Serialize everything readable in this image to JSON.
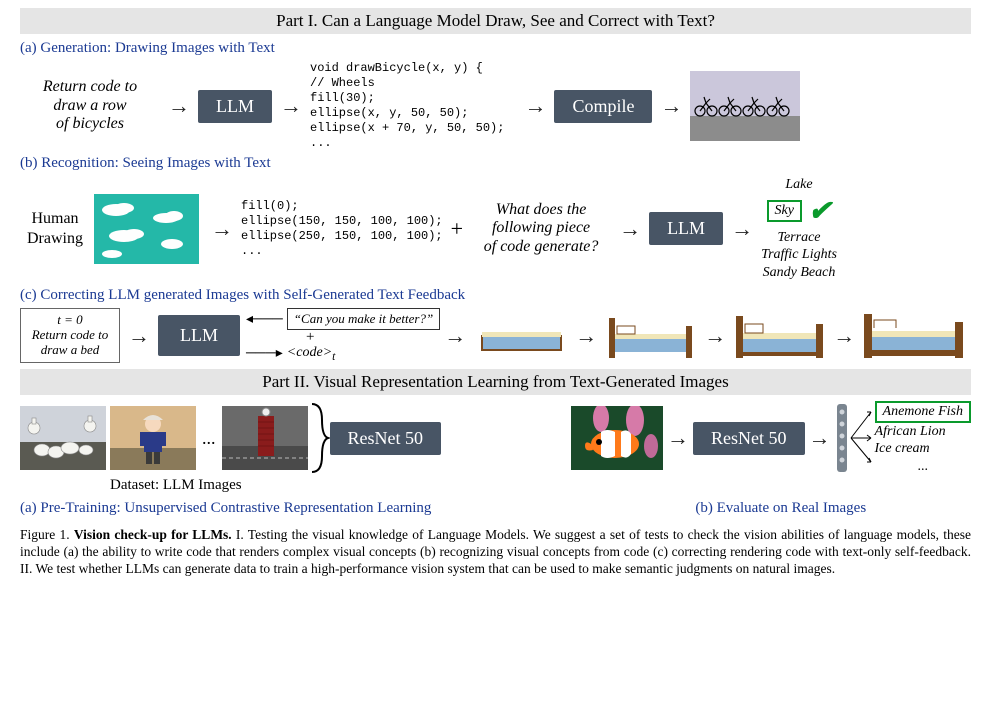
{
  "part1": {
    "banner": "Part I. Can a Language Model Draw, See and Correct with Text?",
    "a": {
      "title": "(a) Generation: Drawing Images with Text",
      "prompt_l1": "Return code to",
      "prompt_l2": "draw a row",
      "prompt_l3": "of bicycles",
      "llm": "LLM",
      "code": "void drawBicycle(x, y) {\n// Wheels\nfill(30);\nellipse(x, y, 50, 50);\nellipse(x + 70, y, 50, 50);\n...",
      "compile": "Compile"
    },
    "b": {
      "title": "(b) Recognition: Seeing Images with Text",
      "human_l1": "Human",
      "human_l2": "Drawing",
      "code": "fill(0);\nellipse(150, 150, 100, 100);\nellipse(250, 150, 100, 100);\n...",
      "question_l1": "What does the",
      "question_l2": "following piece",
      "question_l3": "of code generate?",
      "llm": "LLM",
      "opts": {
        "o1": "Lake",
        "o2": "Sky",
        "o3": "Terrace",
        "o4": "Traffic Lights",
        "o5": "Sandy Beach"
      }
    },
    "c": {
      "title": "(c) Correcting LLM generated Images with Self-Generated Text Feedback",
      "t0_l1": "t = 0",
      "t0_l2": "Return code to",
      "t0_l3": "draw a bed",
      "llm": "LLM",
      "feedback": "“Can you make it better?”",
      "plus": "+",
      "codetok": "<code>",
      "codetok_sub": "t"
    }
  },
  "part2": {
    "banner": "Part II. Visual Representation Learning from Text-Generated Images",
    "ellipsis": "...",
    "resnet": "ResNet 50",
    "dataset": "Dataset: LLM Images",
    "a_title": "(a) Pre-Training: Unsupervised Contrastive Representation Learning",
    "b_title": "(b) Evaluate on Real Images",
    "preds": {
      "p1": "Anemone Fish",
      "p2": "African Lion",
      "p3": "Ice cream"
    },
    "ellipsis2": "..."
  },
  "caption": {
    "lead": "Figure 1.",
    "bold": "Vision check-up for LLMs.",
    "body": " I. Testing the visual knowledge of Language Models. We suggest a set of tests to check the vision abilities of language models, these include (a) the ability to write code that renders complex visual concepts (b) recognizing visual concepts from code (c) correcting rendering code with text-only self-feedback. II. We test whether LLMs can generate data to train a high-performance vision system that can be used to make semantic judgments on natural images."
  }
}
